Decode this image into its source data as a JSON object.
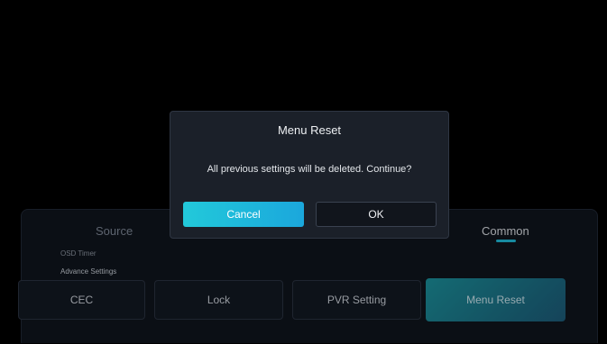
{
  "panel": {
    "tabs": {
      "source": "Source",
      "common": "Common"
    },
    "sub_items": {
      "osd_timer": "OSD Timer",
      "advance_settings": "Advance Settings"
    },
    "options": {
      "cec": "CEC",
      "lock": "Lock",
      "pvr": "PVR Setting",
      "menu_reset": "Menu Reset"
    }
  },
  "dialog": {
    "title": "Menu Reset",
    "message": "All previous settings will be deleted. Continue?",
    "cancel_label": "Cancel",
    "ok_label": "OK"
  },
  "colors": {
    "accent": "#1fb9d6",
    "cancel_gradient_start": "#22c9da",
    "cancel_gradient_end": "#1ba7dc",
    "selected_tile": "#1b7f8f",
    "dialog_bg": "#1b2029",
    "panel_bg": "#0f141c"
  }
}
